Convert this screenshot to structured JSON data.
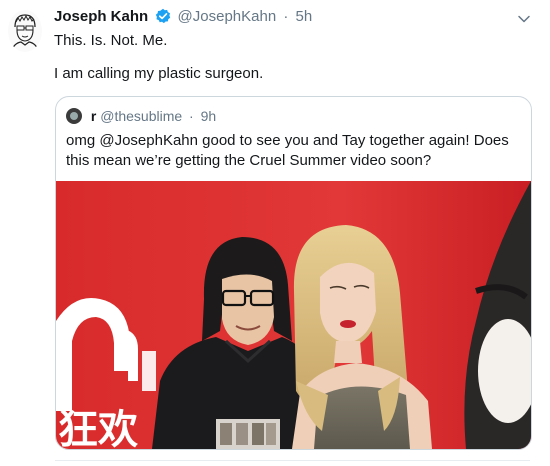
{
  "tweet": {
    "author_name": "Joseph Kahn",
    "handle": "@JosephKahn",
    "separator": "·",
    "time": "5h",
    "line1": "This. Is. Not. Me.",
    "line2": "I am calling my plastic surgeon.",
    "verified_color": "#1da1f2"
  },
  "quoted": {
    "author_name": "r",
    "handle": "@thesublime",
    "separator": "·",
    "time": "9h",
    "text": "omg @JosephKahn good to see you and Tay together again! Does this mean we’re getting the Cruel Summer video soon?"
  },
  "photo": {
    "sign_text": "狂欢",
    "background_color": "#d92b2b"
  },
  "icons": [
    "author-avatar",
    "verified-badge-icon",
    "chevron-down-icon",
    "quoted-author-avatar"
  ]
}
